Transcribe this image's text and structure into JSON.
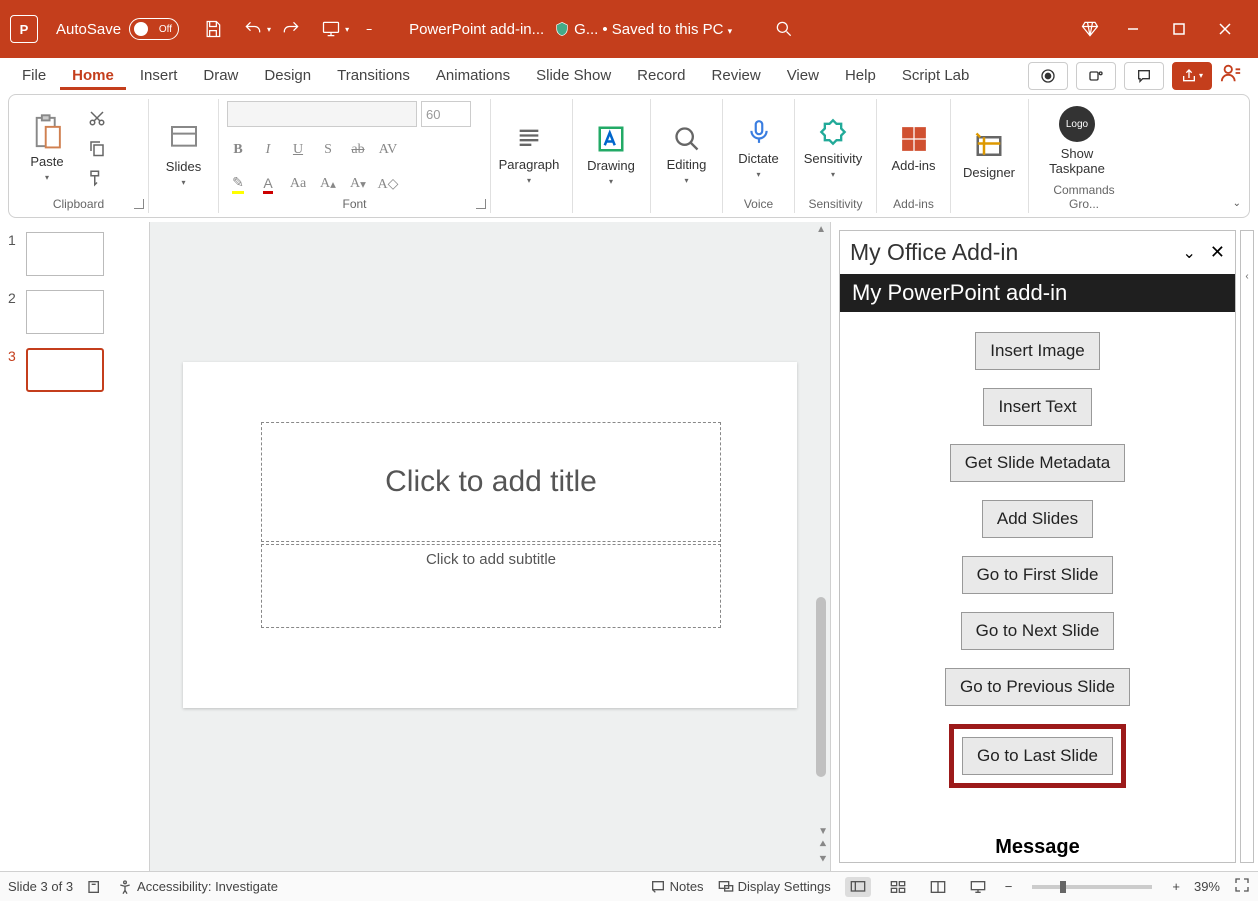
{
  "titlebar": {
    "autosave_label": "AutoSave",
    "autosave_state": "Off",
    "doc_title": "PowerPoint add-in...",
    "sensitivity_short": "G...",
    "save_status": "• Saved to this PC"
  },
  "tabs": [
    "File",
    "Home",
    "Insert",
    "Draw",
    "Design",
    "Transitions",
    "Animations",
    "Slide Show",
    "Record",
    "Review",
    "View",
    "Help",
    "Script Lab"
  ],
  "active_tab": "Home",
  "ribbon": {
    "clipboard": {
      "paste": "Paste",
      "label": "Clipboard"
    },
    "slides": {
      "slides": "Slides"
    },
    "font": {
      "label": "Font",
      "size_value": "60"
    },
    "paragraph": "Paragraph",
    "drawing": "Drawing",
    "editing": "Editing",
    "dictate": "Dictate",
    "voice_label": "Voice",
    "sensitivity": "Sensitivity",
    "sensitivity_label": "Sensitivity",
    "addins": "Add-ins",
    "addins_label": "Add-ins",
    "designer": "Designer",
    "taskpane_btn": "Show Taskpane",
    "logo_text": "Logo",
    "commands_label": "Commands Gro..."
  },
  "thumbs": {
    "count": 3,
    "selected": 3
  },
  "slide": {
    "title_placeholder": "Click to add title",
    "subtitle_placeholder": "Click to add subtitle"
  },
  "taskpane": {
    "pane_title": "My Office Add-in",
    "subtitle": "My PowerPoint add-in",
    "buttons": {
      "insert_image": "Insert Image",
      "insert_text": "Insert Text",
      "get_metadata": "Get Slide Metadata",
      "add_slides": "Add Slides",
      "go_first": "Go to First Slide",
      "go_next": "Go to Next Slide",
      "go_prev": "Go to Previous Slide",
      "go_last": "Go to Last Slide"
    },
    "message_label": "Message"
  },
  "statusbar": {
    "slide_info": "Slide 3 of 3",
    "accessibility": "Accessibility: Investigate",
    "notes": "Notes",
    "display_settings": "Display Settings",
    "zoom": "39%"
  }
}
